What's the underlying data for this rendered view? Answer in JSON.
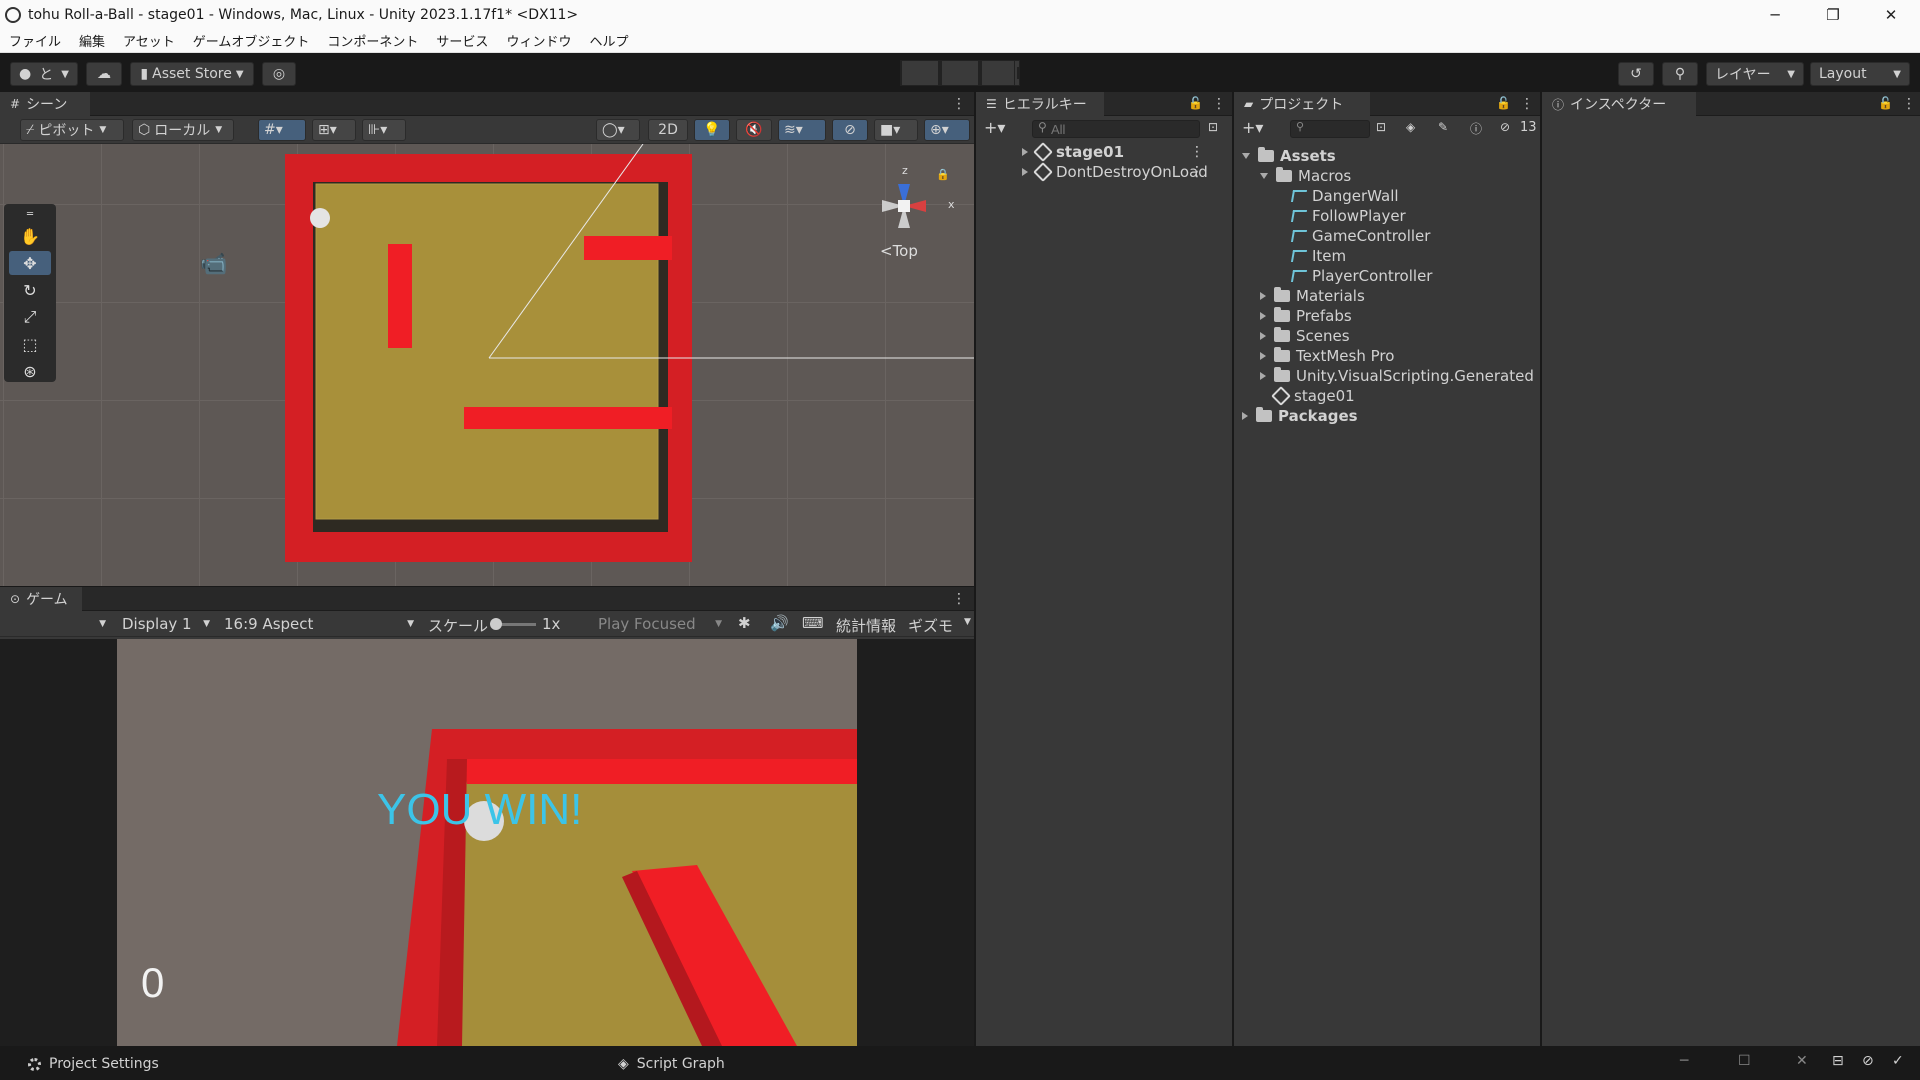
{
  "window": {
    "title": "tohu Roll-a-Ball - stage01 - Windows, Mac, Linux - Unity 2023.1.17f1* <DX11>",
    "minimize": "─",
    "maximize": "❐",
    "close": "✕"
  },
  "menu": [
    "ファイル",
    "編集",
    "アセット",
    "ゲームオブジェクト",
    "コンポーネント",
    "サービス",
    "ウィンドウ",
    "ヘルプ"
  ],
  "toolbar": {
    "account_label": "と",
    "asset_store": "Asset Store",
    "layers": "レイヤー",
    "layout": "Layout"
  },
  "scene": {
    "tab": "シーン",
    "pivot": "ピボット",
    "local": "ローカル",
    "mode_2d": "2D",
    "gizmo_top": "<Top",
    "axis_x": "x",
    "axis_z": "z"
  },
  "game": {
    "tab": "ゲーム",
    "display": "Display 1",
    "aspect": "16:9 Aspect",
    "scale_label": "スケール",
    "scale_value": "1x",
    "play_mode": "Play Focused",
    "stats": "統計情報",
    "gizmos": "ギズモ",
    "win_text": "YOU WIN!",
    "score": "0"
  },
  "hierarchy": {
    "tab": "ヒエラルキー",
    "search_placeholder": "All",
    "items": [
      "stage01",
      "DontDestroyOnLoad"
    ]
  },
  "project": {
    "tab": "プロジェクト",
    "hidden_count": "13",
    "assets": "Assets",
    "macros": "Macros",
    "scripts": [
      "DangerWall",
      "FollowPlayer",
      "GameController",
      "Item",
      "PlayerController"
    ],
    "folders": [
      "Materials",
      "Prefabs",
      "Scenes",
      "TextMesh Pro",
      "Unity.VisualScripting.Generated"
    ],
    "scene_file": "stage01",
    "packages": "Packages"
  },
  "inspector": {
    "tab": "インスペクター"
  },
  "status": {
    "project_settings": "Project Settings",
    "script_graph": "Script Graph"
  },
  "colors": {
    "wall_red": "#d41f24",
    "floor": "#a8903a",
    "accent_blue": "#46607c",
    "win_text": "#3cc4e8"
  }
}
